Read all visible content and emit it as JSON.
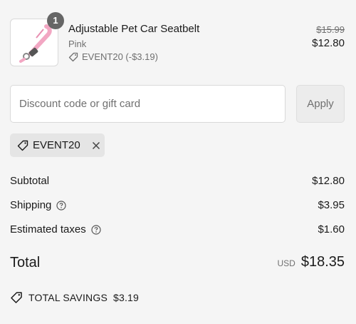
{
  "product": {
    "quantity": "1",
    "name": "Adjustable Pet Car Seatbelt",
    "variant": "Pink",
    "discount_line": "EVENT20 (-$3.19)",
    "original_price": "$15.99",
    "price": "$12.80",
    "image_icon": "pink-seatbelt-leash-image"
  },
  "discount": {
    "placeholder": "Discount code or gift card",
    "apply_label": "Apply"
  },
  "applied_code": {
    "code": "EVENT20"
  },
  "summary": {
    "subtotal_label": "Subtotal",
    "subtotal_value": "$12.80",
    "shipping_label": "Shipping",
    "shipping_value": "$3.95",
    "taxes_label": "Estimated taxes",
    "taxes_value": "$1.60",
    "total_label": "Total",
    "currency": "USD",
    "total_value": "$18.35",
    "savings_label": "TOTAL SAVINGS",
    "savings_value": "$3.19"
  },
  "colors": {
    "background": "#f5f5f5",
    "badge": "#666666",
    "product_pink": "#f2a7c3"
  }
}
